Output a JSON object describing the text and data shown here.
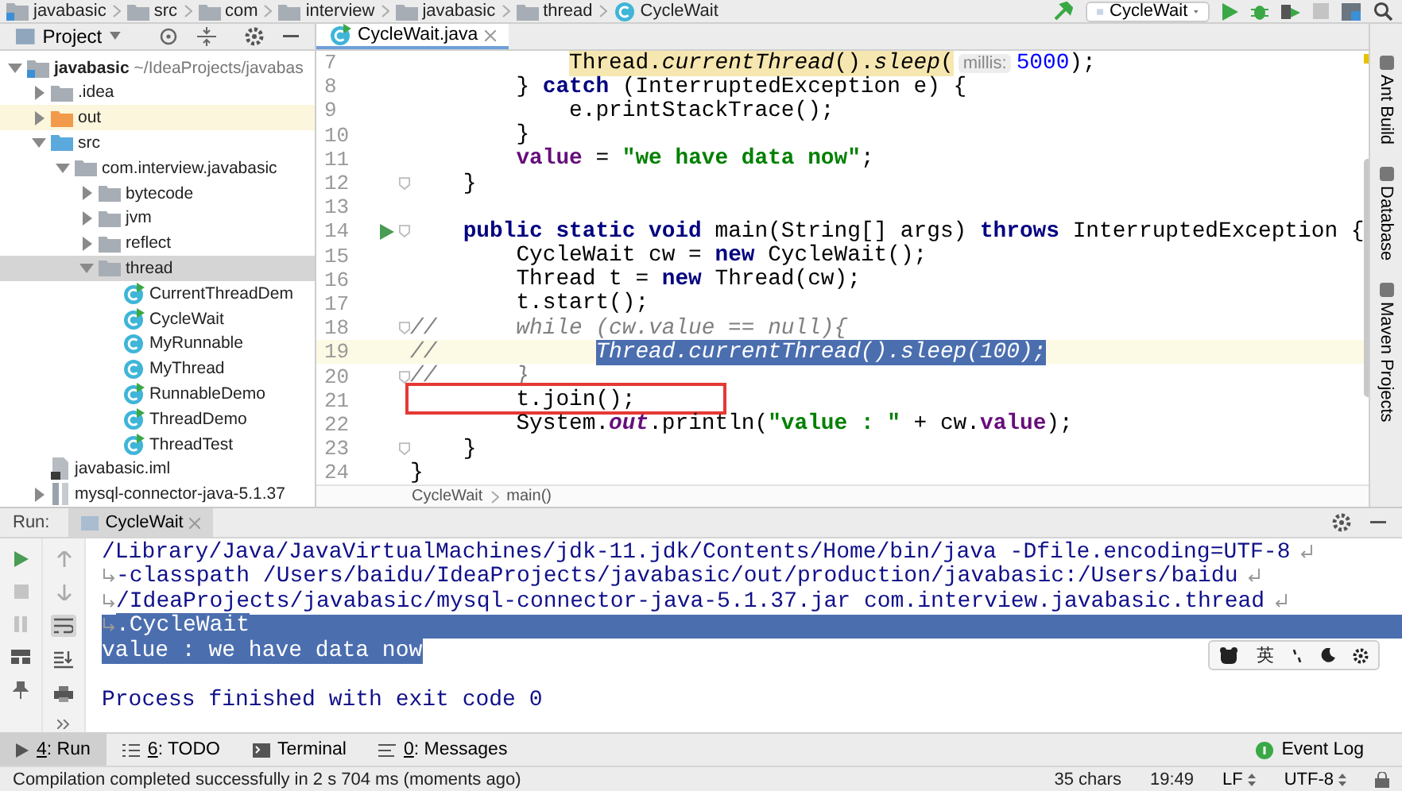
{
  "navbar": {
    "breadcrumbs": [
      {
        "label": "javabasic",
        "kind": "module"
      },
      {
        "label": "src",
        "kind": "folder"
      },
      {
        "label": "com",
        "kind": "folder"
      },
      {
        "label": "interview",
        "kind": "folder"
      },
      {
        "label": "javabasic",
        "kind": "folder"
      },
      {
        "label": "thread",
        "kind": "folder"
      },
      {
        "label": "CycleWait",
        "kind": "class"
      }
    ],
    "run_config": "CycleWait"
  },
  "project_panel": {
    "title": "Project",
    "tree": [
      {
        "label": "javabasic",
        "path": "~/IdeaProjects/javabas",
        "kind": "module",
        "expanded": true,
        "selected": false,
        "highlighted": false,
        "children": [
          {
            "label": ".idea",
            "kind": "folder",
            "expanded": false,
            "selected": false,
            "highlighted": false
          },
          {
            "label": "out",
            "kind": "excluded-folder",
            "expanded": false,
            "selected": false,
            "highlighted": true
          },
          {
            "label": "src",
            "kind": "source-folder",
            "expanded": true,
            "selected": false,
            "highlighted": false,
            "children": [
              {
                "label": "com.interview.javabasic",
                "kind": "package",
                "expanded": true,
                "selected": false,
                "highlighted": false,
                "children": [
                  {
                    "label": "bytecode",
                    "kind": "package",
                    "expanded": false,
                    "selected": false,
                    "highlighted": false
                  },
                  {
                    "label": "jvm",
                    "kind": "package",
                    "expanded": false,
                    "selected": false,
                    "highlighted": false
                  },
                  {
                    "label": "reflect",
                    "kind": "package",
                    "expanded": false,
                    "selected": false,
                    "highlighted": false
                  },
                  {
                    "label": "thread",
                    "kind": "package",
                    "expanded": true,
                    "selected": true,
                    "highlighted": false,
                    "children": [
                      {
                        "label": "CurrentThreadDem",
                        "kind": "runnable-class",
                        "selected": false,
                        "highlighted": false
                      },
                      {
                        "label": "CycleWait",
                        "kind": "runnable-class",
                        "selected": false,
                        "highlighted": false
                      },
                      {
                        "label": "MyRunnable",
                        "kind": "class",
                        "selected": false,
                        "highlighted": false
                      },
                      {
                        "label": "MyThread",
                        "kind": "class",
                        "selected": false,
                        "highlighted": false
                      },
                      {
                        "label": "RunnableDemo",
                        "kind": "runnable-class",
                        "selected": false,
                        "highlighted": false
                      },
                      {
                        "label": "ThreadDemo",
                        "kind": "runnable-class",
                        "selected": false,
                        "highlighted": false
                      },
                      {
                        "label": "ThreadTest",
                        "kind": "runnable-class",
                        "selected": false,
                        "highlighted": false
                      }
                    ]
                  }
                ]
              }
            ]
          },
          {
            "label": "javabasic.iml",
            "kind": "file",
            "selected": false,
            "highlighted": false
          },
          {
            "label": "mysql-connector-java-5.1.37",
            "kind": "library",
            "expanded": false,
            "selected": false,
            "highlighted": false
          }
        ]
      }
    ]
  },
  "editor": {
    "tabs": [
      {
        "label": "CycleWait.java",
        "selected": true
      }
    ],
    "lines": [
      {
        "number": "7",
        "current": false,
        "run_marker": false,
        "fold": false,
        "boxed": false,
        "tokens": [
          {
            "kind": "usage",
            "text": "            Thread."
          },
          {
            "kind": "usage-italic",
            "text": "currentThread"
          },
          {
            "kind": "usage",
            "text": "()."
          },
          {
            "kind": "usage-italic",
            "text": "sleep"
          },
          {
            "kind": "usage",
            "text": "("
          },
          {
            "kind": "hint",
            "text": "millis:"
          },
          {
            "kind": "number",
            "text": "5000"
          },
          {
            "kind": "plain",
            "text": ");"
          }
        ]
      },
      {
        "number": "8",
        "current": false,
        "run_marker": false,
        "fold": false,
        "boxed": false,
        "tokens": [
          {
            "kind": "plain",
            "text": "        } "
          },
          {
            "kind": "keyword",
            "text": "catch"
          },
          {
            "kind": "plain",
            "text": " (InterruptedException e) {"
          }
        ]
      },
      {
        "number": "9",
        "current": false,
        "run_marker": false,
        "fold": false,
        "boxed": false,
        "tokens": [
          {
            "kind": "plain",
            "text": "            e.printStackTrace();"
          }
        ]
      },
      {
        "number": "10",
        "current": false,
        "run_marker": false,
        "fold": false,
        "boxed": false,
        "tokens": [
          {
            "kind": "plain",
            "text": "        }"
          }
        ]
      },
      {
        "number": "11",
        "current": false,
        "run_marker": false,
        "fold": false,
        "boxed": false,
        "tokens": [
          {
            "kind": "field",
            "text": "        value"
          },
          {
            "kind": "plain",
            "text": " = "
          },
          {
            "kind": "string",
            "text": "\"we have data now\""
          },
          {
            "kind": "plain",
            "text": ";"
          }
        ]
      },
      {
        "number": "12",
        "current": false,
        "run_marker": false,
        "fold": true,
        "boxed": false,
        "tokens": [
          {
            "kind": "plain",
            "text": "    }"
          }
        ]
      },
      {
        "number": "13",
        "current": false,
        "run_marker": false,
        "fold": false,
        "boxed": false
      },
      {
        "number": "14",
        "current": false,
        "run_marker": true,
        "fold": true,
        "boxed": false,
        "tokens": [
          {
            "kind": "keyword",
            "text": "    public static void"
          },
          {
            "kind": "plain",
            "text": " main(String[] args) "
          },
          {
            "kind": "keyword",
            "text": "throws"
          },
          {
            "kind": "plain",
            "text": " InterruptedException {"
          }
        ]
      },
      {
        "number": "15",
        "current": false,
        "run_marker": false,
        "fold": false,
        "boxed": false,
        "tokens": [
          {
            "kind": "plain",
            "text": "        CycleWait cw = "
          },
          {
            "kind": "keyword",
            "text": "new"
          },
          {
            "kind": "plain",
            "text": " CycleWait();"
          }
        ]
      },
      {
        "number": "16",
        "current": false,
        "run_marker": false,
        "fold": false,
        "boxed": false,
        "tokens": [
          {
            "kind": "plain",
            "text": "        Thread t = "
          },
          {
            "kind": "keyword",
            "text": "new"
          },
          {
            "kind": "plain",
            "text": " Thread(cw);"
          }
        ]
      },
      {
        "number": "17",
        "current": false,
        "run_marker": false,
        "fold": false,
        "boxed": false,
        "tokens": [
          {
            "kind": "plain",
            "text": "        t.start();"
          }
        ]
      },
      {
        "number": "18",
        "current": false,
        "run_marker": false,
        "fold": true,
        "boxed": false,
        "tokens": [
          {
            "kind": "comment",
            "text": "//      while (cw.value == null){"
          }
        ]
      },
      {
        "number": "19",
        "current": true,
        "run_marker": false,
        "fold": false,
        "boxed": false,
        "tokens": [
          {
            "kind": "comment",
            "text": "//           "
          },
          {
            "kind": "selected-comment",
            "text": " Thread.currentThread().sleep(100);"
          }
        ]
      },
      {
        "number": "20",
        "current": false,
        "run_marker": false,
        "fold": true,
        "boxed": false,
        "tokens": [
          {
            "kind": "comment",
            "text": "//      }"
          }
        ]
      },
      {
        "number": "21",
        "current": false,
        "run_marker": false,
        "fold": false,
        "boxed": true,
        "tokens": [
          {
            "kind": "plain",
            "text": "        t.join();"
          }
        ]
      },
      {
        "number": "22",
        "current": false,
        "run_marker": false,
        "fold": false,
        "boxed": false,
        "tokens": [
          {
            "kind": "plain",
            "text": "        System."
          },
          {
            "kind": "static-field",
            "text": "out"
          },
          {
            "kind": "plain",
            "text": ".println("
          },
          {
            "kind": "string",
            "text": "\"value : \""
          },
          {
            "kind": "plain",
            "text": " + cw."
          },
          {
            "kind": "field",
            "text": "value"
          },
          {
            "kind": "plain",
            "text": ");"
          }
        ]
      },
      {
        "number": "23",
        "current": false,
        "run_marker": false,
        "fold": true,
        "boxed": false,
        "tokens": [
          {
            "kind": "plain",
            "text": "    }"
          }
        ]
      },
      {
        "number": "24",
        "current": false,
        "run_marker": false,
        "fold": false,
        "boxed": false,
        "tokens": [
          {
            "kind": "plain",
            "text": "}"
          }
        ]
      }
    ],
    "breadcrumbs": [
      "CycleWait",
      "main()"
    ]
  },
  "side_tools": [
    "Ant Build",
    "Database",
    "Maven Projects"
  ],
  "run_panel": {
    "label": "Run:",
    "tabs": [
      {
        "label": "CycleWait",
        "selected": true
      }
    ],
    "soft_wrap": true,
    "console": [
      {
        "kind": "text",
        "text": "/Library/Java/JavaVirtualMachines/jdk-11.jdk/Contents/Home/bin/java -Dfile.encoding=UTF-8",
        "wrap_in": false,
        "wrap_out": true,
        "selected": false,
        "line_selected": false
      },
      {
        "kind": "text",
        "text": "-classpath /Users/baidu/IdeaProjects/javabasic/out/production/javabasic:/Users/baidu",
        "wrap_in": true,
        "wrap_out": true,
        "selected": false,
        "line_selected": false
      },
      {
        "kind": "text",
        "text": "/IdeaProjects/javabasic/mysql-connector-java-5.1.37.jar com.interview.javabasic.thread",
        "wrap_in": true,
        "wrap_out": true,
        "selected": false,
        "line_selected": false
      },
      {
        "kind": "text",
        "text": ".CycleWait",
        "wrap_in": true,
        "wrap_out": false,
        "selected": true,
        "line_selected": true
      },
      {
        "kind": "text",
        "text": "value : we have data now",
        "wrap_in": false,
        "wrap_out": false,
        "selected": true,
        "line_selected": false
      },
      {
        "kind": "blank"
      },
      {
        "kind": "text",
        "text": "Process finished with exit code 0",
        "wrap_in": false,
        "wrap_out": false,
        "selected": false,
        "line_selected": false
      }
    ]
  },
  "ime_toolbar": {
    "label": "英"
  },
  "tool_windows": [
    {
      "mnemonic": "4",
      "label": ": Run",
      "selected": true,
      "kind": "run"
    },
    {
      "mnemonic": "6",
      "label": ": TODO",
      "selected": false,
      "kind": "todo"
    },
    {
      "label": "Terminal",
      "selected": false,
      "kind": "terminal"
    },
    {
      "mnemonic": "0",
      "label": ": Messages",
      "selected": false,
      "kind": "messages"
    }
  ],
  "event_log": "Event Log",
  "status_bar": {
    "message": "Compilation completed successfully in 2 s 704 ms (moments ago)",
    "chars": "35 chars",
    "position": "19:49",
    "line_separator": "LF",
    "encoding": "UTF-8"
  }
}
